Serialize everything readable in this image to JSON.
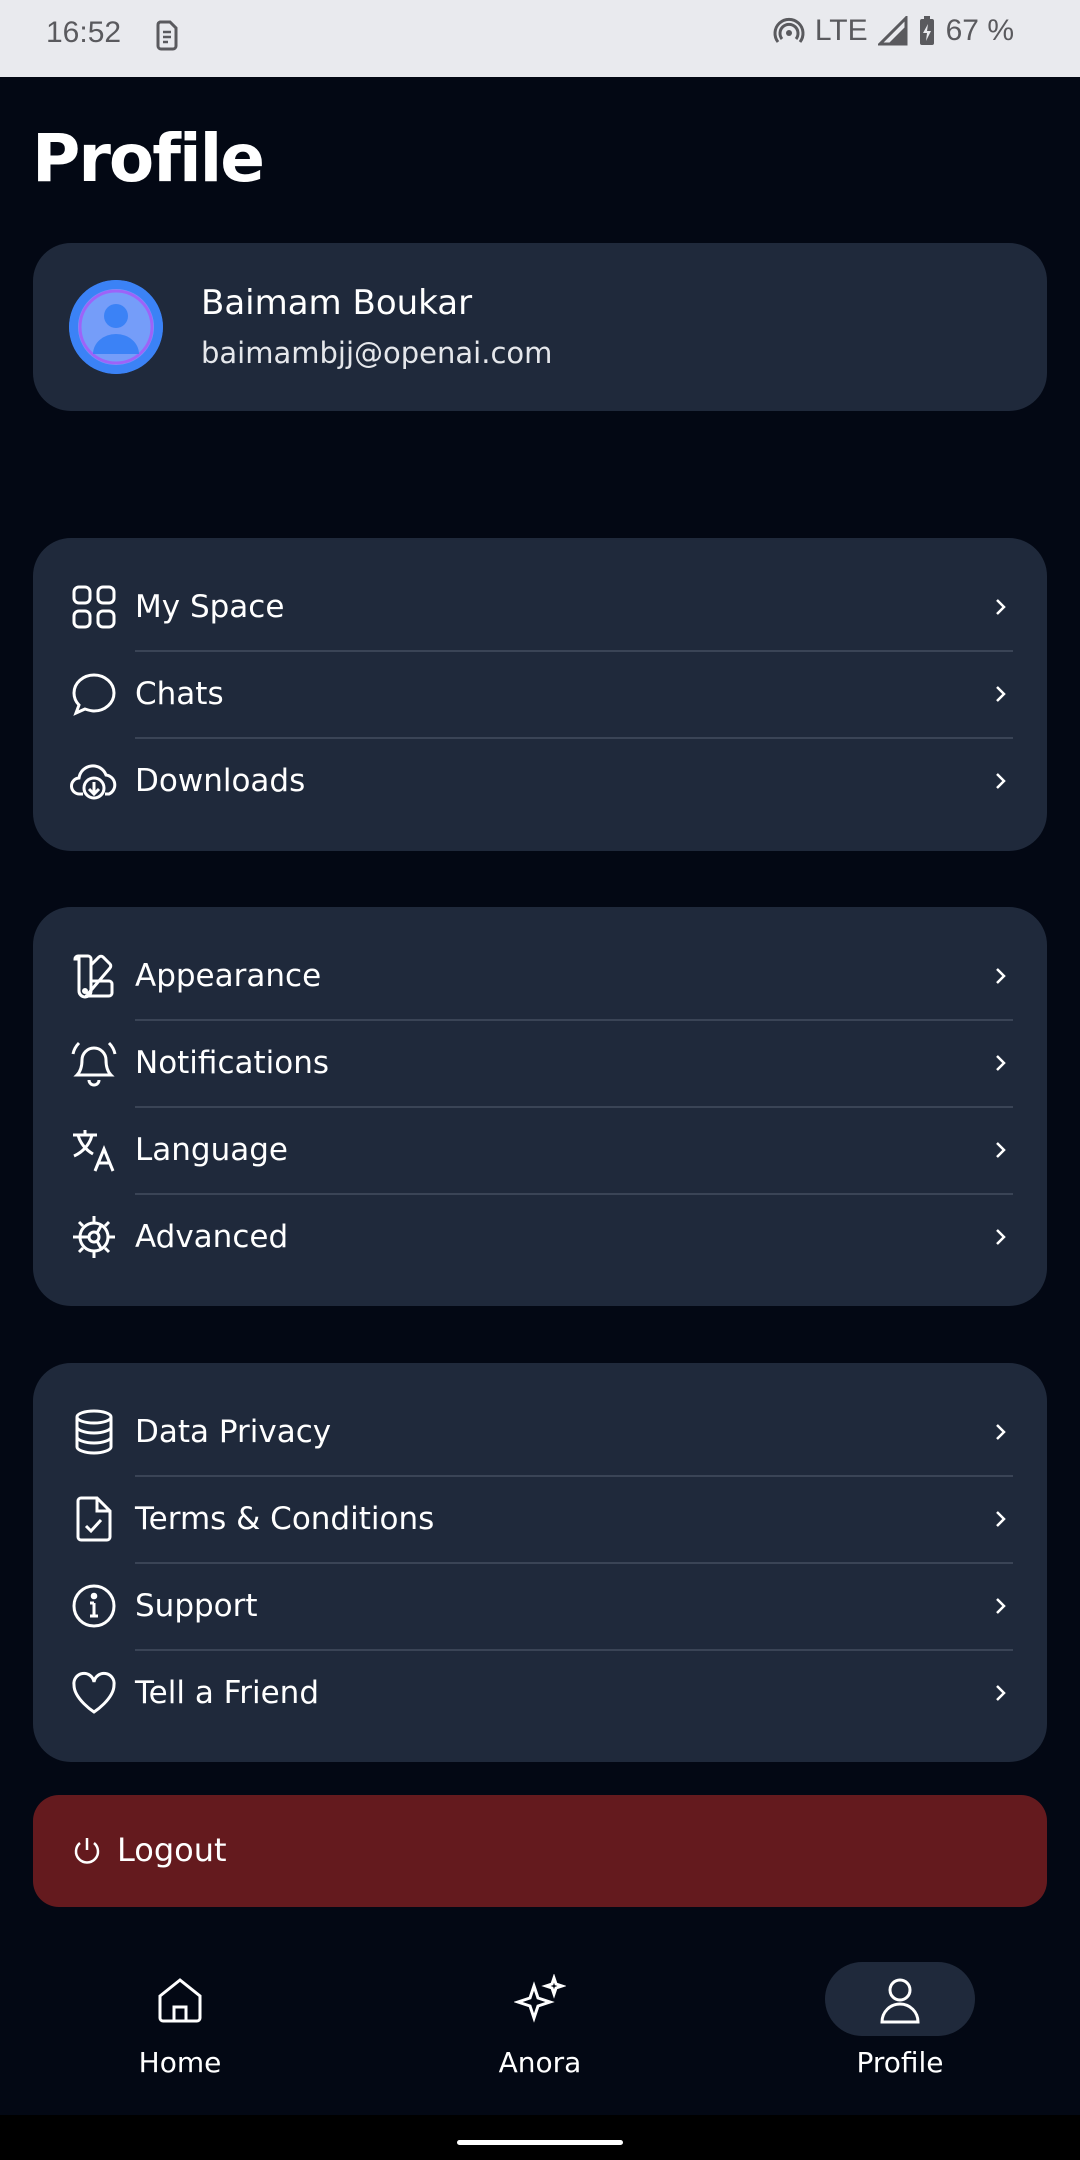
{
  "status_bar": {
    "time": "16:52",
    "network": "LTE",
    "battery": "67 %",
    "icons": [
      "sim-card-icon",
      "hotspot-icon",
      "signal-icon",
      "battery-charging-icon"
    ]
  },
  "page": {
    "title": "Profile"
  },
  "profile": {
    "name": "Baimam Boukar",
    "email": "baimambjj@openai.com",
    "avatar_color": "#3b82f6"
  },
  "groups": [
    {
      "items": [
        {
          "label": "My Space",
          "icon": "grid-icon"
        },
        {
          "label": "Chats",
          "icon": "chat-bubble-icon"
        },
        {
          "label": "Downloads",
          "icon": "cloud-download-icon"
        }
      ]
    },
    {
      "items": [
        {
          "label": "Appearance",
          "icon": "palette-swatch-icon"
        },
        {
          "label": "Notifications",
          "icon": "bell-ringing-icon"
        },
        {
          "label": "Language",
          "icon": "translate-icon"
        },
        {
          "label": "Advanced",
          "icon": "cog-icon"
        }
      ]
    },
    {
      "items": [
        {
          "label": "Data Privacy",
          "icon": "database-icon"
        },
        {
          "label": "Terms & Conditions",
          "icon": "document-check-icon"
        },
        {
          "label": "Support",
          "icon": "info-circle-icon"
        },
        {
          "label": "Tell a Friend",
          "icon": "heart-icon"
        }
      ]
    }
  ],
  "logout": {
    "label": "Logout",
    "icon": "power-icon",
    "color": "#641a1e"
  },
  "bottom_nav": [
    {
      "label": "Home",
      "icon": "home-icon",
      "active": false
    },
    {
      "label": "Anora",
      "icon": "sparkles-icon",
      "active": false
    },
    {
      "label": "Profile",
      "icon": "user-icon",
      "active": true
    }
  ],
  "colors": {
    "background": "#030814",
    "card": "#1f293b",
    "divider": "#3a4456"
  }
}
